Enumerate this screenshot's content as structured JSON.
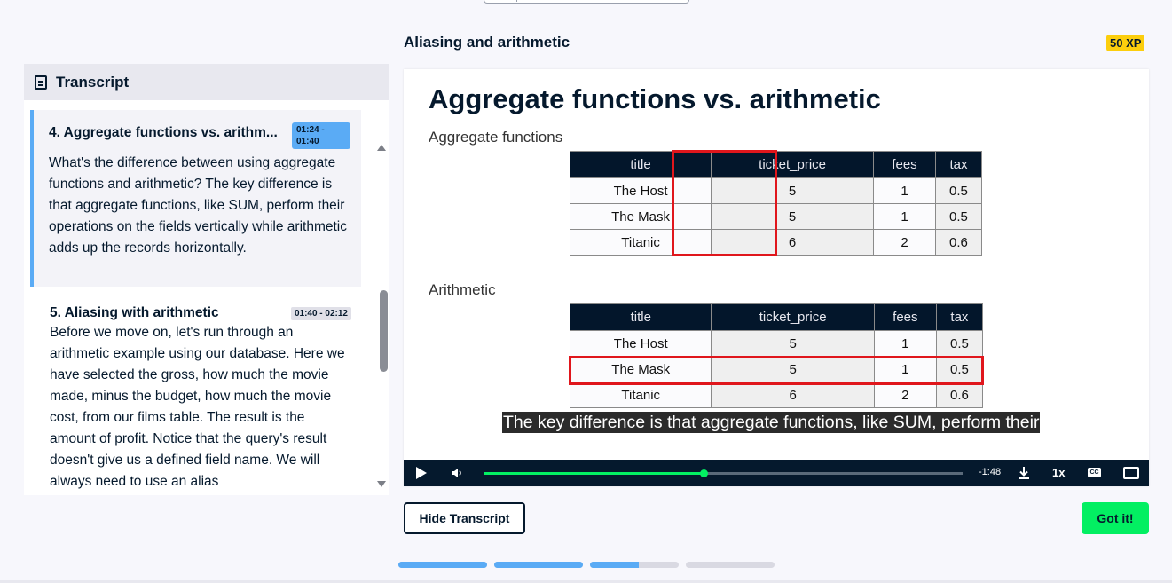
{
  "lesson": {
    "title": "Aliasing and arithmetic",
    "xp": "50 XP"
  },
  "transcript": {
    "title": "Transcript",
    "entries": [
      {
        "title": "4. Aggregate functions vs. arithm...",
        "time": "01:24 - 01:40",
        "active": true,
        "text": "What's the difference between using aggregate functions and arithmetic? The key difference is that aggregate functions, like SUM, perform their operations on the fields vertically while arithmetic adds up the records horizontally."
      },
      {
        "title": "5. Aliasing with arithmetic",
        "time": "01:40 - 02:12",
        "active": false,
        "text": "Before we move on, let's run through an arithmetic example using our database. Here we have selected the gross, how much the movie made, minus the budget, how much the movie cost, from our films table. The result is the amount of profit. Notice that the query's result doesn't give us a defined field name. We will always need to use an alias"
      }
    ]
  },
  "slide": {
    "title": "Aggregate functions vs. arithmetic",
    "aggregate_label": "Aggregate functions",
    "arithmetic_label": "Arithmetic",
    "columns": [
      "title",
      "ticket_price",
      "fees",
      "tax"
    ],
    "rows": [
      [
        "The Host",
        "5",
        "1",
        "0.5"
      ],
      [
        "The Mask",
        "5",
        "1",
        "0.5"
      ],
      [
        "Titanic",
        "6",
        "2",
        "0.6"
      ]
    ],
    "caption": "The key difference is that aggregate functions, like SUM, perform their"
  },
  "player": {
    "time_remaining": "-1:48",
    "speed": "1x",
    "cc_label": "CC",
    "progress_fraction": 0.46
  },
  "buttons": {
    "hide_transcript": "Hide Transcript",
    "got_it": "Got it!"
  },
  "steps": [
    1,
    1,
    0.55,
    0
  ],
  "colors": {
    "accent_green": "#03ef62",
    "accent_blue": "#5aabf5",
    "xp_yellow": "#fcce0d",
    "navy": "#05192d",
    "highlight_red": "#e0161c"
  }
}
